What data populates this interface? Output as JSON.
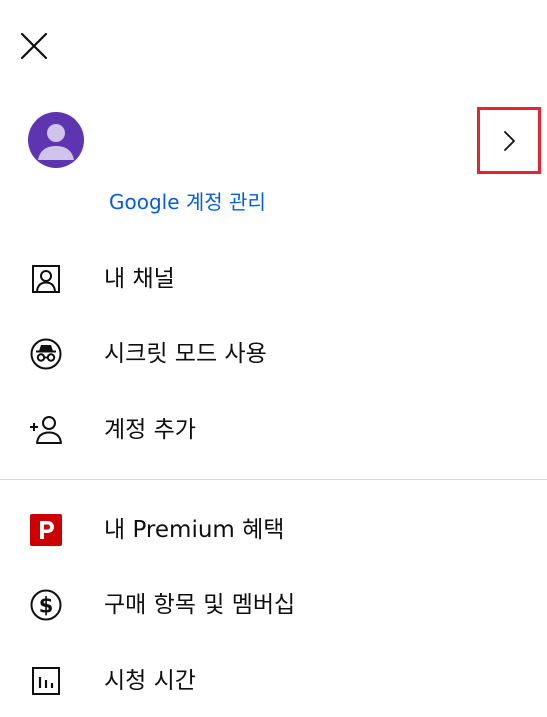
{
  "account": {
    "manage_label": "Google 계정 관리"
  },
  "menu": {
    "my_channel": "내 채널",
    "incognito": "시크릿 모드 사용",
    "add_account": "계정 추가",
    "premium_benefits": "내 Premium 혜택",
    "purchases_memberships": "구매 항목 및 멤버십",
    "time_watched": "시청 시간"
  },
  "colors": {
    "link_blue": "#065fd4",
    "avatar_purple": "#5e35b1",
    "premium_red": "#cc0000",
    "highlight_red": "#e3262e"
  },
  "icons": {
    "close": "close-icon",
    "chevron": "chevron-right-icon",
    "my_channel": "person-box-icon",
    "incognito": "incognito-icon",
    "add_account": "person-add-icon",
    "premium": "premium-p-icon",
    "purchases": "dollar-circle-icon",
    "time_watched": "bar-chart-icon"
  }
}
